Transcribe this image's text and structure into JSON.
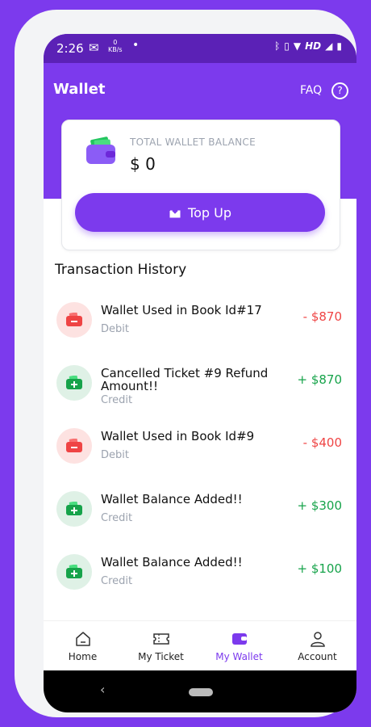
{
  "status_bar": {
    "time": "2:26",
    "data_rate_value": "0",
    "data_rate_unit": "KB/s",
    "network_label": "HD"
  },
  "header": {
    "title": "Wallet",
    "faq_label": "FAQ",
    "help_symbol": "?"
  },
  "balance_card": {
    "label": "TOTAL WALLET BALANCE",
    "value": "$ 0",
    "topup_label": "Top Up",
    "icon": "wallet-icon",
    "topup_icon": "download-icon"
  },
  "transactions": {
    "title": "Transaction History",
    "items": [
      {
        "title": "Wallet Used in Book Id#17",
        "type": "Debit",
        "amount": "- $870"
      },
      {
        "title": "Cancelled Ticket #9 Refund Amount!!",
        "type": "Credit",
        "amount": "+ $870"
      },
      {
        "title": "Wallet Used in Book Id#9",
        "type": "Debit",
        "amount": "- $400"
      },
      {
        "title": "Wallet Balance Added!!",
        "type": "Credit",
        "amount": "+ $300"
      },
      {
        "title": "Wallet Balance Added!!",
        "type": "Credit",
        "amount": "+ $100"
      }
    ]
  },
  "bottom_nav": {
    "items": [
      {
        "label": "Home",
        "icon": "home-icon"
      },
      {
        "label": "My Ticket",
        "icon": "ticket-icon"
      },
      {
        "label": "My Wallet",
        "icon": "wallet-icon",
        "active": true
      },
      {
        "label": "Account",
        "icon": "user-icon"
      }
    ]
  },
  "colors": {
    "brand_purple": "#7c3aed",
    "debit_red": "#ef4444",
    "credit_green": "#16a34a"
  }
}
